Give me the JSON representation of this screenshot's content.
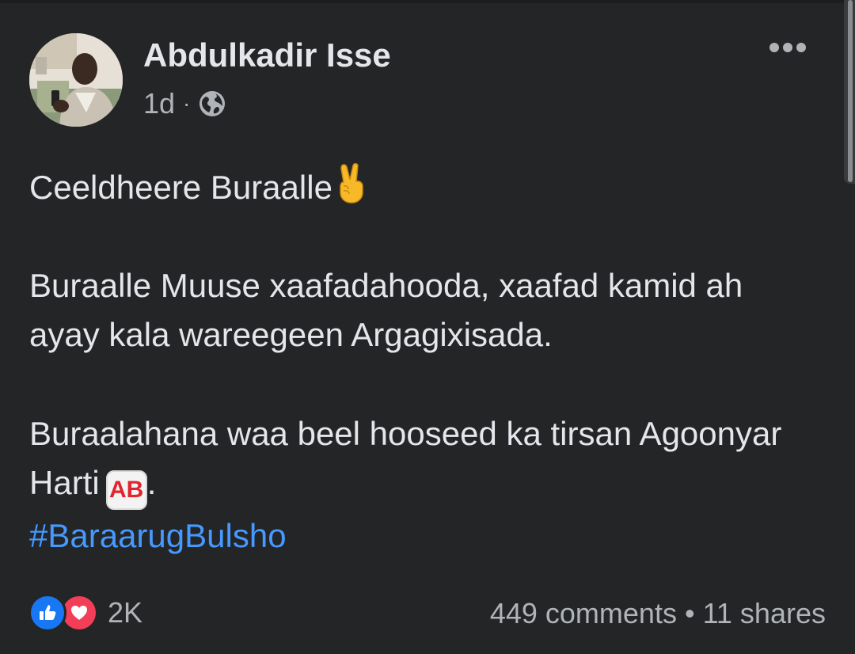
{
  "post": {
    "author": "Abdulkadir Isse",
    "time": "1d",
    "separator": "·",
    "privacy_icon": "globe-icon",
    "menu_icon": "more-options-icon",
    "line1": "Ceeldheere Buraalle",
    "line1_emoji": "victory-hand-emoji",
    "paragraph2": "Buraalle Muuse xaafadahooda, xaafad kamid ah ayay kala wareegeen Argagixisada.",
    "paragraph3": "Buraalahana waa beel hooseed ka tirsan Agoonyar Harti",
    "ab_badge": "AB",
    "paragraph3_end": ".",
    "hashtag": "#BaraarugBulsho"
  },
  "footer": {
    "reaction_icons": [
      "like-icon",
      "love-icon"
    ],
    "reaction_count": "2K",
    "comments": "449 comments",
    "dot": "•",
    "shares": "11 shares"
  },
  "colors": {
    "background": "#242526",
    "text": "#e4e6eb",
    "secondary": "#b0b3b8",
    "link": "#4599ff",
    "like": "#1877f2",
    "love": "#f33e58"
  }
}
